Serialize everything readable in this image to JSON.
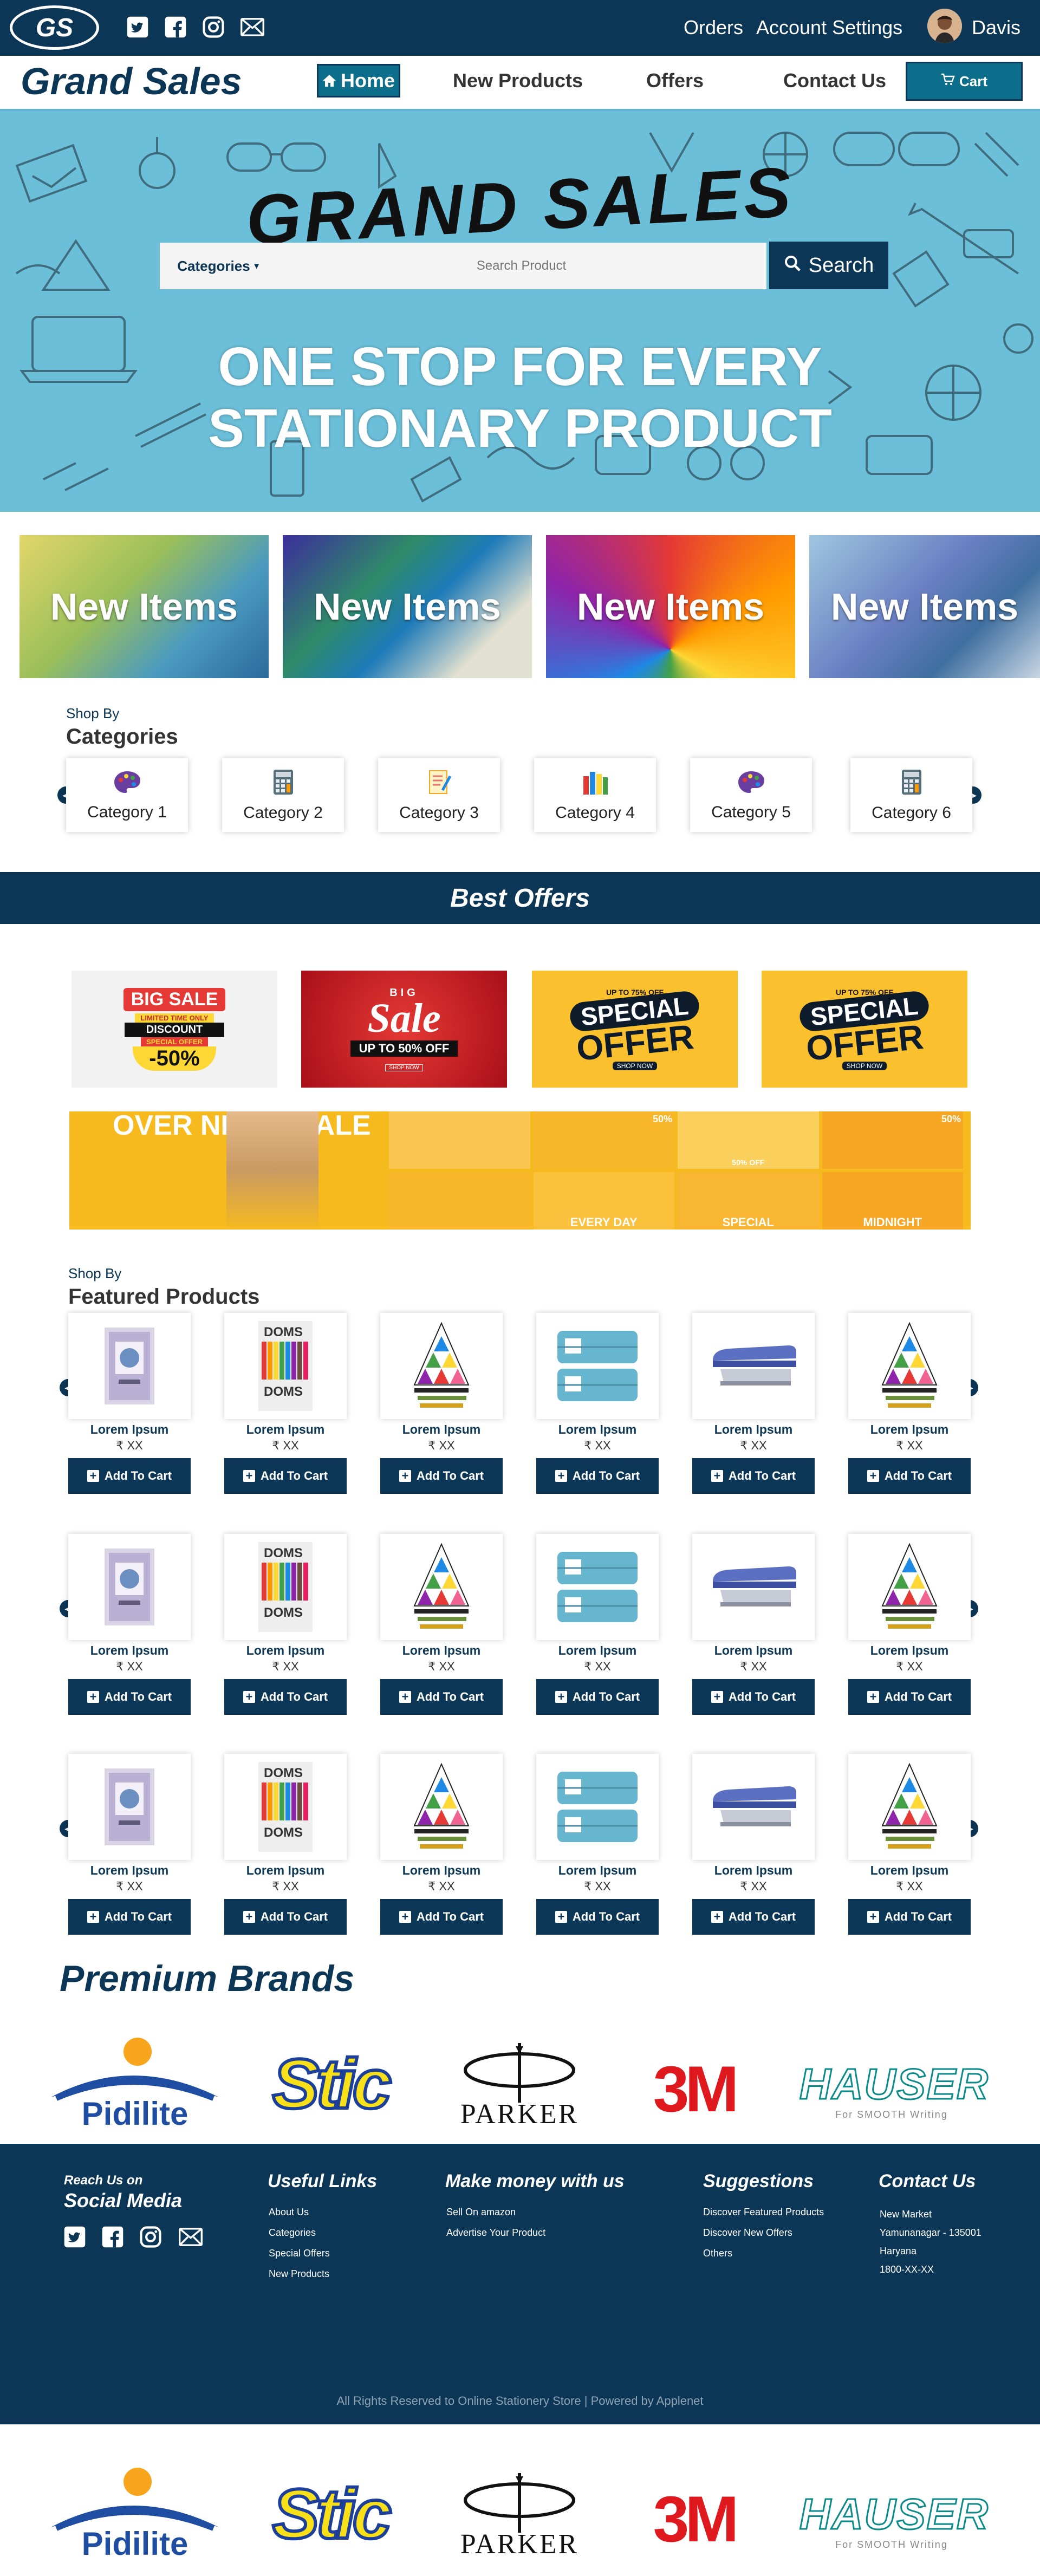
{
  "topbar": {
    "logo": "GS",
    "nav": [
      "Orders",
      "Account Settings"
    ],
    "user": "Davis"
  },
  "navbar": {
    "brand": "Grand Sales",
    "links": [
      "Home",
      "New Products",
      "Offers",
      "Contact Us"
    ],
    "cart": "Cart"
  },
  "hero": {
    "title": "GRAND SALES",
    "categories_label": "Categories",
    "search_placeholder": "Search Product",
    "search_button": "Search",
    "tagline": "ONE STOP FOR EVERY STATIONARY PRODUCT"
  },
  "new_items": [
    "New Items",
    "New Items",
    "New Items",
    "New Items"
  ],
  "categories": {
    "kicker": "Shop By",
    "heading": "Categories",
    "items": [
      "Category 1",
      "Category 2",
      "Category 3",
      "Category 4",
      "Category 5",
      "Category 6"
    ]
  },
  "offers": {
    "heading": "Best Offers",
    "banners": [
      {
        "line1": "BIG SALE",
        "line2": "LIMITED TIME ONLY",
        "line3": "DISCOUNT",
        "line4": "SPECIAL OFFER",
        "line5": "-50%"
      },
      {
        "line1": "BIG",
        "line2": "Sale",
        "line3": "UP TO 50% OFF",
        "line4": "SHOP NOW"
      },
      {
        "line1": "UP TO 75% OFF",
        "line2": "SPECIAL",
        "line3": "OFFER",
        "line4": "SHOP NOW"
      },
      {
        "line1": "UP TO 75% OFF",
        "line2": "SPECIAL",
        "line3": "OFFER",
        "line4": "SHOP NOW"
      }
    ],
    "overnight": {
      "title": "OVER NIGHT SALE",
      "tags": [
        "50%",
        "50% OFF",
        "50%",
        "EVERY DAY",
        "SPECIAL",
        "MIDNIGHT"
      ]
    }
  },
  "featured": {
    "kicker": "Shop By",
    "heading": "Featured Products",
    "product_name": "Lorem Ipsum",
    "price": "₹ XX",
    "add_to_cart": "Add To Cart",
    "product_types": [
      "notebook",
      "crayons",
      "triangle",
      "pouch",
      "stapler",
      "triangle"
    ]
  },
  "brands": {
    "heading": "Premium Brands",
    "items": [
      {
        "name": "Pidilite"
      },
      {
        "name": "Stic"
      },
      {
        "name": "PARKER"
      },
      {
        "name": "3M"
      },
      {
        "name": "HAUSER",
        "tagline": "For SMOOTH Writing"
      }
    ]
  },
  "footer": {
    "reach_label": "Reach Us on",
    "social_label": "Social Media",
    "useful": {
      "title": "Useful Links",
      "links": [
        "About Us",
        "Categories",
        "Special Offers",
        "New Products"
      ]
    },
    "money": {
      "title": "Make money with us",
      "links": [
        "Sell On amazon",
        "Advertise Your Product"
      ]
    },
    "suggestions": {
      "title": "Suggestions",
      "links": [
        "Discover Featured Products",
        "Discover New Offers",
        "Others"
      ]
    },
    "contact": {
      "title": "Contact Us",
      "lines": [
        "New Market",
        "Yamunanagar - 135001",
        "Haryana",
        "1800-XX-XX"
      ]
    },
    "copyright": "All Rights Reserved to Online Stationery Store | Powered by Applenet"
  },
  "colors": {
    "navy": "#0c3655",
    "teal": "#0c6e8a",
    "sky": "#6cbfd9"
  }
}
